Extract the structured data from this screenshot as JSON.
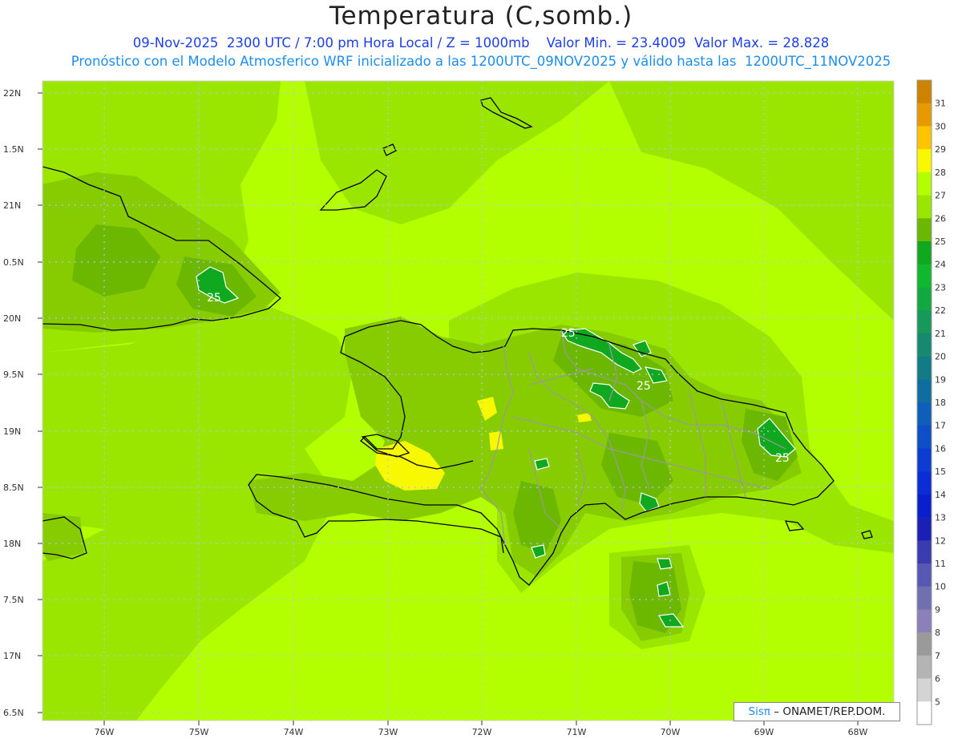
{
  "header": {
    "title": "Temperatura (C,somb.)",
    "subtitle_line1": "09-Nov-2025  2300 UTC / 7:00 pm Hora Local / Z = 1000mb    Valor Min. = 23.4009  Valor Max. = 28.828",
    "subtitle_line2": "Pronóstico con el Modelo Atmosferico WRF inicializado a las 1200UTC_09NOV2025 y válido hasta las  1200UTC_11NOV2025"
  },
  "map": {
    "lon_labels": [
      "76W",
      "75W",
      "74W",
      "73W",
      "72W",
      "71W",
      "70W",
      "69W",
      "68W"
    ],
    "lat_labels": [
      "22N",
      "1.5N",
      "21N",
      "0.5N",
      "20N",
      "9.5N",
      "19N",
      "8.5N",
      "18N",
      "7.5N",
      "17N",
      "6.5N"
    ],
    "contour_labels": [
      "25",
      "25",
      "25",
      "25"
    ],
    "grid": true,
    "colors": {
      "background_28": "#b3ff00",
      "level_27": "#9ae600",
      "level_26": "#86cc00",
      "level_25": "#6cb800",
      "level_24": "#0f9e1e",
      "level_29": "#f8f800"
    }
  },
  "colorbar": {
    "levels": [
      "31",
      "30",
      "29",
      "28",
      "27",
      "26",
      "25",
      "24",
      "23",
      "22",
      "21",
      "20",
      "19",
      "18",
      "17",
      "16",
      "15",
      "14",
      "13",
      "12",
      "11",
      "10",
      "9",
      "8",
      "7",
      "6",
      "5"
    ],
    "colors": [
      "#cc8400",
      "#e69a00",
      "#ffc400",
      "#f8f800",
      "#b3ff00",
      "#9ae600",
      "#6cb800",
      "#0fa81e",
      "#10b830",
      "#14a840",
      "#16995a",
      "#168a6e",
      "#127c86",
      "#0f6ea0",
      "#0f5fb8",
      "#0f4fc6",
      "#0d3dd0",
      "#0b2dd6",
      "#0a1fcc",
      "#1a20b4",
      "#3b3bb0",
      "#5757b4",
      "#7070b0",
      "#8c80b8",
      "#9a9a9a",
      "#b4b4b4",
      "#d4d4d4",
      "#ffffff"
    ]
  },
  "credit": {
    "sis": "Sisπ",
    "text": "– ONAMET/REP.DOM."
  }
}
